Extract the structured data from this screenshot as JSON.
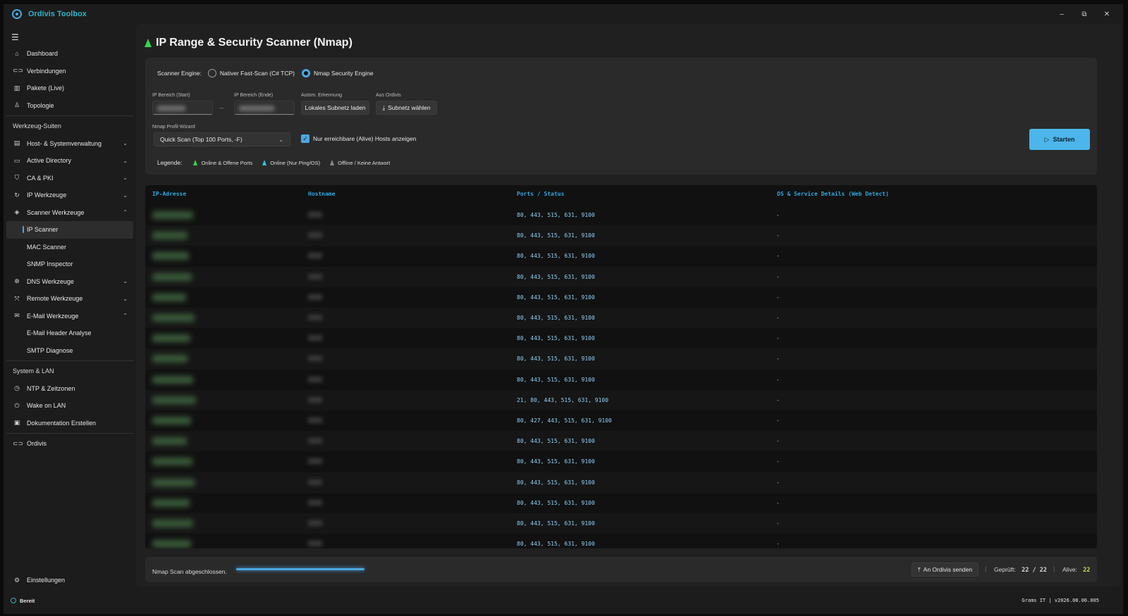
{
  "app": {
    "title": "Ordivis Toolbox",
    "controls": {
      "minimize": "–",
      "maximize": "⧉",
      "close": "✕"
    }
  },
  "sidebar": {
    "top_items": [
      {
        "label": "Dashboard",
        "icon": "home-icon"
      },
      {
        "label": "Verbindungen",
        "icon": "link-icon"
      },
      {
        "label": "Pakete (Live)",
        "icon": "stats-icon"
      },
      {
        "label": "Topologie",
        "icon": "topology-icon"
      }
    ],
    "section_tools": "Werkzeug-Suiten",
    "tools": [
      {
        "label": "Host- & Systemverwaltung",
        "icon": "server-icon"
      },
      {
        "label": "Active Directory",
        "icon": "folder-icon"
      },
      {
        "label": "CA & PKI",
        "icon": "shield-icon"
      },
      {
        "label": "IP Werkzeuge",
        "icon": "refresh-icon"
      },
      {
        "label": "Scanner Werkzeuge",
        "icon": "layers-icon"
      }
    ],
    "scanner_sub": [
      "IP Scanner",
      "MAC Scanner",
      "SNMP Inspector"
    ],
    "tools2": [
      {
        "label": "DNS Werkzeuge",
        "icon": "globe-icon"
      },
      {
        "label": "Remote Werkzeuge",
        "icon": "remote-icon"
      },
      {
        "label": "E-Mail Werkzeuge",
        "icon": "mail-icon"
      }
    ],
    "mail_sub": [
      "E-Mail Header Analyse",
      "SMTP Diagnose"
    ],
    "section_system": "System & LAN",
    "system": [
      {
        "label": "NTP & Zeitzonen",
        "icon": "clock-icon"
      },
      {
        "label": "Wake on LAN",
        "icon": "power-icon"
      },
      {
        "label": "Dokumentation Erstellen",
        "icon": "document-icon"
      }
    ],
    "ordivis": "Ordivis",
    "settings": "Einstellungen"
  },
  "page": {
    "title": "IP Range & Security Scanner (Nmap)"
  },
  "config": {
    "engine_label": "Scanner Engine:",
    "engine_options": [
      "Nativer Fast-Scan (C# TCP)",
      "Nmap Security Engine"
    ],
    "engine_selected": "Nmap Security Engine",
    "ip_start_label": "IP Bereich (Start)",
    "ip_end_label": "IP Bereich (Ende)",
    "dash": "–",
    "auto_label": "Autom. Erkennung",
    "auto_btn": "Lokales Subnetz laden",
    "ordivis_label": "Aus Ordivis",
    "ordivis_btn": "Subnetz wählen",
    "profile_label": "Nmap Profil-Wizard",
    "profile_value": "Quick Scan (Top 100 Ports, -F)",
    "alive_only_label": "Nur erreichbare (Alive) Hosts anzeigen",
    "alive_only_checked": true,
    "legend_label": "Legende:",
    "legend": [
      {
        "label": "Online & Offene Ports",
        "color": "#3ad24b"
      },
      {
        "label": "Online (Nur Ping/OS)",
        "color": "#2fc7d6"
      },
      {
        "label": "Offline / Keine Antwort",
        "color": "#8a8a8a"
      }
    ],
    "start_btn": "Starten"
  },
  "table": {
    "columns": [
      "IP-Adresse",
      "Hostname",
      "Ports / Status",
      "OS & Service Details (Web Detect)"
    ],
    "rows": [
      {
        "ports": "80, 443, 515, 631, 9100",
        "details": "-"
      },
      {
        "ports": "80, 443, 515, 631, 9100",
        "details": "-"
      },
      {
        "ports": "80, 443, 515, 631, 9100",
        "details": "-"
      },
      {
        "ports": "80, 443, 515, 631, 9100",
        "details": "-"
      },
      {
        "ports": "80, 443, 515, 631, 9100",
        "details": "-"
      },
      {
        "ports": "80, 443, 515, 631, 9100",
        "details": "-"
      },
      {
        "ports": "80, 443, 515, 631, 9100",
        "details": "-"
      },
      {
        "ports": "80, 443, 515, 631, 9100",
        "details": "-"
      },
      {
        "ports": "80, 443, 515, 631, 9100",
        "details": "-"
      },
      {
        "ports": "21, 80, 443, 515, 631, 9100",
        "details": "-"
      },
      {
        "ports": "80, 427, 443, 515, 631, 9100",
        "details": "-"
      },
      {
        "ports": "80, 443, 515, 631, 9100",
        "details": "-"
      },
      {
        "ports": "80, 443, 515, 631, 9100",
        "details": "-"
      },
      {
        "ports": "80, 443, 515, 631, 9100",
        "details": "-"
      },
      {
        "ports": "80, 443, 515, 631, 9100",
        "details": "-"
      },
      {
        "ports": "80, 443, 515, 631, 9100",
        "details": "-"
      },
      {
        "ports": "80, 443, 515, 631, 9100",
        "details": "-"
      }
    ]
  },
  "footer": {
    "status": "Nmap Scan abgeschlossen.",
    "progress": 1.0,
    "send_btn": "An Ordivis senden",
    "checked_label": "Geprüft:",
    "checked_value": "22 / 22",
    "alive_label": "Alive:",
    "alive_value": "22",
    "alive_color": "#c9d94a"
  },
  "statusbar": {
    "ready": "Bereit",
    "version": "Grams IT | v2026.08.06.005"
  },
  "colors": {
    "accent": "#4aa8e0",
    "brand": "#2fb3c7",
    "port_text": "#8fd0f5"
  }
}
